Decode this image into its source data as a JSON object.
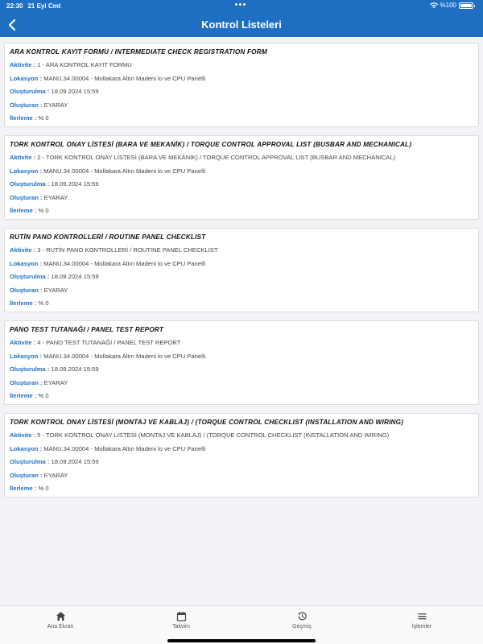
{
  "status": {
    "time": "22:30",
    "date": "21 Eyl Cmt",
    "battery": "%100",
    "battery_level": 1.0
  },
  "header": {
    "title": "Kontrol Listeleri",
    "back_icon": "chevron-left-icon",
    "color": "#1e6fc2"
  },
  "labels": {
    "activity": "Aktivite :",
    "location": "Lokasyon :",
    "created_at": "Oluşturulma :",
    "created_by": "Oluşturan :",
    "progress": "İlerleme :"
  },
  "items": [
    {
      "title": "ARA KONTROL KAYIT FORMU / INTERMEDIATE CHECK REGISTRATION FORM",
      "activity": "1 - ARA KONTROL KAYIT FORMU",
      "location": "MANU.34.00004 - Mollakara Altın Madeni lo ve CPU Panelli",
      "created_at": "18.09.2024 15:59",
      "created_by": "EYARAY",
      "progress": "% 0"
    },
    {
      "title": "TORK KONTROL ONAY LİSTESİ (BARA VE MEKANİK) / TORQUE CONTROL APPROVAL LIST (BUSBAR AND MECHANICAL)",
      "activity": "2 - TORK KONTROL ONAY LİSTESİ (BARA VE MEKANİK) / TORQUE CONTROL APPROVAL LIST (BUSBAR AND MECHANICAL)",
      "location": "MANU.34.00004 - Mollakara Altın Madeni lo ve CPU Panelli",
      "created_at": "18.09.2024 15:59",
      "created_by": "EYARAY",
      "progress": "% 0"
    },
    {
      "title": "RUTİN PANO KONTROLLERİ / ROUTINE PANEL CHECKLIST",
      "activity": "3 - RUTİN PANO KONTROLLERİ / ROUTINE PANEL CHECKLIST",
      "location": "MANU.34.00004 - Mollakara Altın Madeni lo ve CPU Panelli",
      "created_at": "18.09.2024 15:59",
      "created_by": "EYARAY",
      "progress": "% 0"
    },
    {
      "title": "PANO TEST TUTANAĞI / PANEL TEST REPORT",
      "activity": "4 - PANO TEST TUTANAĞI / PANEL TEST REPORT",
      "location": "MANU.34.00004 - Mollakara Altın Madeni lo ve CPU Panelli",
      "created_at": "18.09.2024 15:59",
      "created_by": "EYARAY",
      "progress": "% 0"
    },
    {
      "title": "TORK KONTROL ONAY LİSTESİ (MONTAJ VE KABLAJ) / (TORQUE CONTROL CHECKLIST (INSTALLATION AND WIRING)",
      "activity": "5 - TORK KONTROL ONAY LİSTESİ (MONTAJ VE KABLAJ) / (TORQUE CONTROL CHECKLIST (INSTALLATION AND WIRING)",
      "location": "MANU.34.00004 - Mollakara Altın Madeni lo ve CPU Panelli",
      "created_at": "18.09.2024 15:59",
      "created_by": "EYARAY",
      "progress": "% 0"
    }
  ],
  "tabs": [
    {
      "label": "Ana Ekran",
      "icon": "home-icon"
    },
    {
      "label": "Takvim",
      "icon": "calendar-icon"
    },
    {
      "label": "Geçmiş",
      "icon": "history-icon"
    },
    {
      "label": "İşlemler",
      "icon": "menu-icon"
    }
  ]
}
